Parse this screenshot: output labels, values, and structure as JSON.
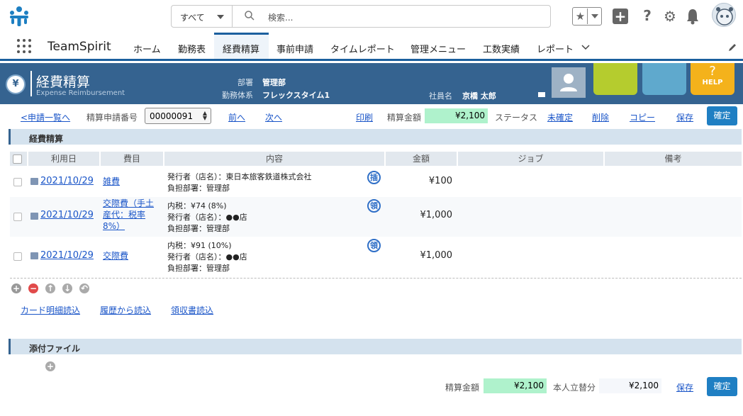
{
  "search": {
    "scope": "すべて",
    "placeholder": "検索..."
  },
  "nav": {
    "app_name": "TeamSpirit",
    "items": [
      "ホーム",
      "勤務表",
      "経費精算",
      "事前申請",
      "タイムレポート",
      "管理メニュー",
      "工数実績",
      "レポート"
    ],
    "active": "経費精算"
  },
  "header": {
    "title": "経費精算",
    "subtitle": "Expense Reimbursement",
    "dept_label": "部署",
    "dept_value": "管理部",
    "system_label": "勤務体系",
    "system_value": "フレックスタイム1",
    "employee_label": "社員名",
    "employee_value": "京橋 太郎",
    "help_tile": "HELP"
  },
  "toolbar": {
    "back_link": "<申請一覧へ",
    "request_no_label": "精算申請番号",
    "request_no": "00000091",
    "prev": "前へ",
    "next": "次へ",
    "print": "印刷",
    "amount_label": "精算金額",
    "amount": "¥2,100",
    "status_label": "ステータス",
    "status": "未確定",
    "delete": "削除",
    "copy": "コピー",
    "save": "保存",
    "confirm": "確定"
  },
  "section_expense": "経費精算",
  "table": {
    "headers": [
      "利用日",
      "費目",
      "内容",
      "金額",
      "ジョブ",
      "備考"
    ],
    "rows": [
      {
        "date": "2021/10/29",
        "item": "雑費",
        "lines": [
          "発行者（店名）：東日本旅客鉄道株式会社",
          "負担部署：管理部"
        ],
        "badge": "插",
        "amount": "¥100"
      },
      {
        "date": "2021/10/29",
        "item": "交際費（手土産代：税率8%）",
        "lines": [
          "内税：¥74 (8%)",
          "発行者（店名）：●●店",
          "負担部署：管理部"
        ],
        "badge": "領",
        "amount": "¥1,000"
      },
      {
        "date": "2021/10/29",
        "item": "交際費",
        "lines": [
          "内税：¥91 (10%)",
          "発行者（店名）：●●店",
          "負担部署：管理部"
        ],
        "badge": "領",
        "amount": "¥1,000"
      }
    ]
  },
  "bottom_links": [
    "カード明細読込",
    "履歴から読込",
    "領収書読込"
  ],
  "section_attach": "添付ファイル",
  "footer": {
    "amount_label": "精算金額",
    "amount": "¥2,100",
    "self_label": "本人立替分",
    "self_amount": "¥2,100",
    "save": "保存",
    "confirm": "確定"
  },
  "colors": {
    "header_bg": "#356390",
    "accent": "#1f7fc3",
    "amount_bg": "#aff2cc"
  }
}
